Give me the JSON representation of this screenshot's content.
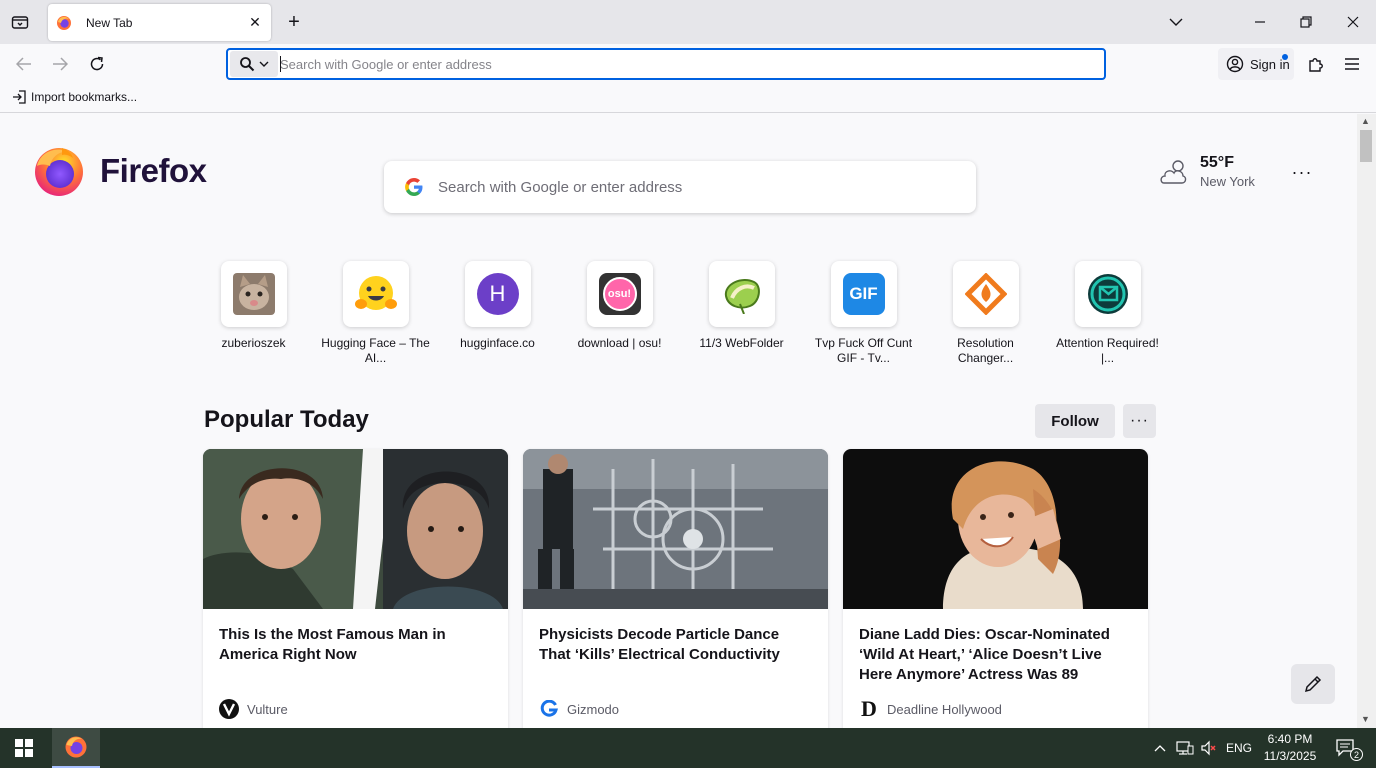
{
  "browser": {
    "tab": {
      "title": "New Tab"
    },
    "urlbar": {
      "placeholder": "Search with Google or enter address"
    },
    "signin_label": "Sign in",
    "bookmarks": {
      "import_label": "Import bookmarks..."
    }
  },
  "newtab": {
    "brand": "Firefox",
    "search_placeholder": "Search with Google or enter address",
    "weather": {
      "temp": "55°F",
      "location": "New York"
    },
    "topsites": [
      {
        "label": "zuberioszek",
        "icon": "cat-photo-icon"
      },
      {
        "label": "Hugging Face – The AI...",
        "icon": "hugging-face-icon"
      },
      {
        "label": "hugginface.co",
        "icon": "letter-h-icon",
        "letter": "H"
      },
      {
        "label": "download | osu!",
        "icon": "osu-icon",
        "letter": "osu!"
      },
      {
        "label": "11/3 WebFolder",
        "icon": "kiwi-icon"
      },
      {
        "label": "Tvp Fuck Off Cunt GIF - Tv...",
        "icon": "gif-icon",
        "letter": "GIF"
      },
      {
        "label": "Resolution Changer...",
        "icon": "resolution-changer-icon"
      },
      {
        "label": "Attention Required! |...",
        "icon": "email-icon"
      }
    ],
    "popular": {
      "title": "Popular Today",
      "follow_label": "Follow",
      "cards": [
        {
          "headline": "This Is the Most Famous Man in America Right Now",
          "source": "Vulture",
          "source_icon": "V"
        },
        {
          "headline": "Physicists Decode Particle Dance That ‘Kills’ Electrical Conductivity",
          "source": "Gizmodo",
          "source_icon": "G"
        },
        {
          "headline": "Diane Ladd Dies: Oscar-Nominated ‘Wild At Heart,’ ‘Alice Doesn’t Live Here Anymore’ Actress Was 89",
          "source": "Deadline Hollywood",
          "source_icon": "D"
        }
      ]
    }
  },
  "taskbar": {
    "language": "ENG",
    "time": "6:40 PM",
    "date": "11/3/2025",
    "notification_count": "2"
  },
  "colors": {
    "accent": "#0061e0",
    "taskbar": "#243329",
    "firefox_wordmark": "#20123a"
  }
}
